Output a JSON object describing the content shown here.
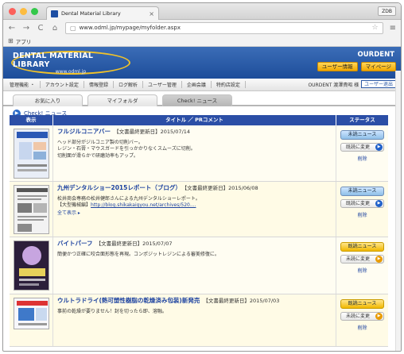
{
  "browser": {
    "tab_title": "Dental Material Library",
    "tab_close": "×",
    "user_button": "ZDB",
    "back": "←",
    "forward": "→",
    "reload": "C",
    "home": "⌂",
    "url": "www.odml.jp/mypage/myfolder.aspx",
    "menu": "≡",
    "bookmark_label": "アプリ"
  },
  "header": {
    "logo_main": "DENTAL MATERIAL LIBRARY",
    "logo_sub": "www.odml.jp",
    "brand": "OURDENT",
    "user_info": "ユーザー情報",
    "mypage": "マイページ"
  },
  "admin_nav": {
    "items": [
      "管理機能 ・",
      "アカウント設定",
      "情報登録",
      "ログ解析",
      "ユーザー管理",
      "企画会議",
      "特約店設定"
    ],
    "user_text": "OURDENT 渡澤貴昭 様",
    "logout": "ユーザー退出"
  },
  "tabs": [
    "お気に入り",
    "マイフォルダ",
    "Check! ニュース"
  ],
  "crumb": "Check! ニュース",
  "table": {
    "headers": [
      "表示",
      "タイトル ／ PRコメント",
      "ステータス"
    ],
    "rows": [
      {
        "title": "フルジルコニアバー",
        "meta": "【文書最終更新日】2015/07/14",
        "body": [
          "ヘッド部分がジルコニア製の切削バー。",
          "レジン・石膏・マウスガードを引っかかりなくスムーズに切削。",
          "切削面が滑らかで研磨効率もアップ。"
        ],
        "link": "",
        "more": "",
        "status": "未読ニュース",
        "change": "既読に変更",
        "delete": "削除"
      },
      {
        "title": "九州デンタルショー2015レポート（ブログ）",
        "meta": "【文書最終更新日】2015/06/08",
        "body": [
          "松井商会専務の松井健郎さんによる九州デンタルショーレポート。"
        ],
        "link_prefix": "【大型機械編】",
        "link": "http://blog.shikakaigyou.net/archives/520....",
        "more": "全て表示 ▸",
        "status": "未読ニュース",
        "change": "既読に変更",
        "delete": "削除"
      },
      {
        "title": "バイトパーフ",
        "meta": "【文書最終更新日】2015/07/07",
        "body": [
          "簡便かつ正確に咬合面形態を再現。コンポジットレジンによる審美修復に。"
        ],
        "link": "",
        "more": "",
        "status": "既読ニュース",
        "change": "未読に変更",
        "delete": "削除"
      },
      {
        "title": "ウルトラドライ(熱可塑性樹脂の乾燥済み包装)新発売",
        "meta": "【文書最終更新日】2015/07/03",
        "body": [
          "事前の乾燥が要りません！封を切ったら即、溶融。"
        ],
        "link": "",
        "more": "",
        "status": "既読ニュース",
        "change": "未読に変更",
        "delete": "削除"
      }
    ]
  },
  "colors": {
    "header_blue": "#1d4d9a",
    "table_head": "#2b4ea6",
    "gold": "#f0c22a",
    "row_bg": "#fffdf2"
  }
}
